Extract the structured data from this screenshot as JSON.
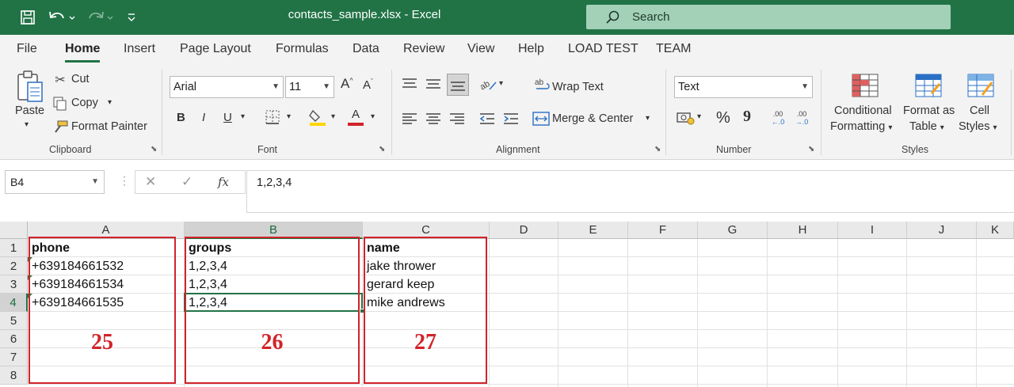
{
  "window": {
    "title": "contacts_sample.xlsx  -  Excel",
    "search_label": "Search",
    "quick_access": [
      "save-icon",
      "undo-icon",
      "redo-icon",
      "customize-qat-icon"
    ]
  },
  "menu": {
    "tabs": [
      "File",
      "Home",
      "Insert",
      "Page Layout",
      "Formulas",
      "Data",
      "Review",
      "View",
      "Help",
      "LOAD TEST",
      "TEAM"
    ],
    "active": "Home"
  },
  "ribbon": {
    "clipboard": {
      "label": "Clipboard",
      "paste": "Paste",
      "cut": "Cut",
      "copy": "Copy",
      "format_painter": "Format Painter"
    },
    "font": {
      "label": "Font",
      "font_name": "Arial",
      "font_size": "11",
      "bold": "B",
      "italic": "I",
      "underline": "U",
      "increase": "A",
      "decrease": "A",
      "font_color": "A",
      "highlight_color": "#ffd600",
      "font_color_value": "#d2232a"
    },
    "alignment": {
      "label": "Alignment",
      "wrap_text": "Wrap Text",
      "merge_center": "Merge & Center"
    },
    "number": {
      "label": "Number",
      "format": "Text",
      "percent": "%",
      "comma": "9",
      "inc_decimal": ".00",
      "dec_decimal": ".00"
    },
    "styles": {
      "label": "Styles",
      "conditional_1": "Conditional",
      "conditional_2": "Formatting",
      "format_table_1": "Format as",
      "format_table_2": "Table",
      "cell_styles_1": "Cell",
      "cell_styles_2": "Styles"
    }
  },
  "formula_bar": {
    "name_box": "B4",
    "fx": "fx",
    "content": "1,2,3,4"
  },
  "grid": {
    "columns": [
      "A",
      "B",
      "C",
      "D",
      "E",
      "F",
      "G",
      "H",
      "I",
      "J",
      "K"
    ],
    "rows": [
      "1",
      "2",
      "3",
      "4",
      "5",
      "6",
      "7",
      "8"
    ],
    "selected_column": "B",
    "selected_row": "4",
    "cells": {
      "A1": "phone",
      "B1": "groups",
      "C1": "name",
      "A2": "+639184661532",
      "B2": "1,2,3,4",
      "C2": "jake thrower",
      "A3": "+639184661534",
      "B3": "1,2,3,4",
      "C3": "gerard keep",
      "A4": "+639184661535",
      "B4": "1,2,3,4",
      "C4": "mike andrews"
    }
  },
  "annotations": {
    "box_a": "25",
    "box_b": "26",
    "box_c": "27",
    "color": "#d2232a"
  }
}
